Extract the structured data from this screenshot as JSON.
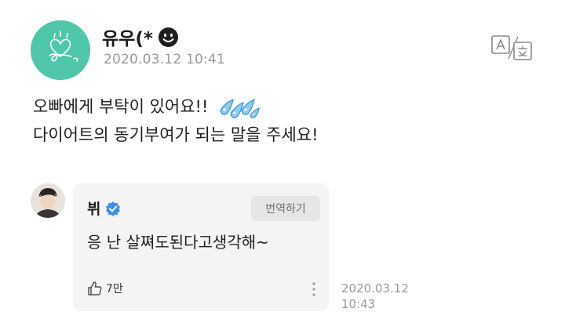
{
  "post": {
    "author": "유우(*",
    "author_emoji": "smiling-face-emoji",
    "avatar_icon": "heart-sketch-avatar",
    "date": "2020.03.12 10:41",
    "translate_icon": "translate-icon",
    "lines": [
      "오빠에게 부탁이 있어요!!",
      "다이어트의 동기부여가 되는 말을 주세요!"
    ],
    "line_emoji": "sweat-droplets-emoji"
  },
  "reply": {
    "author": "뷔",
    "verified_icon": "verified-badge-icon",
    "translate_button": "번역하기",
    "text": "응 난 살쪄도된다고생각해~",
    "like_icon": "thumbs-up-icon",
    "likes": "7만",
    "more_icon": "more-vertical-icon",
    "date": "2020.03.12\n10:43"
  },
  "colors": {
    "avatar_bg": "#4fc6aa",
    "verified_blue": "#3d8ef0",
    "date_gray": "#9a9a9a",
    "card_bg": "#f4f4f5"
  }
}
